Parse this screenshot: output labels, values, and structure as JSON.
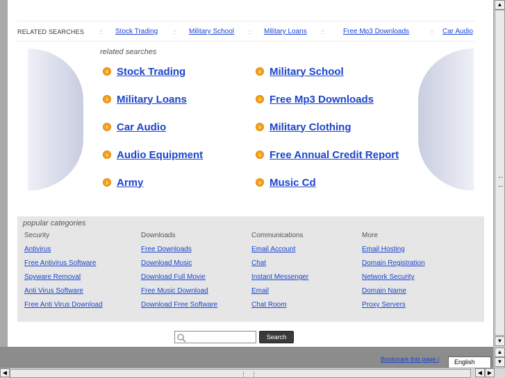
{
  "top_bar": {
    "label": "RELATED SEARCHES",
    "separator": "::",
    "links": [
      "Stock Trading",
      "Military School",
      "Military Loans",
      "Free Mp3 Downloads",
      "Car Audio"
    ]
  },
  "related": {
    "title": "related searches",
    "items": [
      "Stock Trading",
      "Military School",
      "Military Loans",
      "Free Mp3 Downloads",
      "Car Audio",
      "Military Clothing",
      "Audio Equipment",
      "Free Annual Credit Report",
      "Army",
      "Music Cd"
    ]
  },
  "popular": {
    "title": "popular categories",
    "columns": [
      {
        "heading": "Security",
        "links": [
          "Antivirus",
          "Free Antivirus Software",
          "Spyware Removal",
          "Anti Virus Software",
          "Free Anti Virus Download"
        ]
      },
      {
        "heading": "Downloads",
        "links": [
          "Free Downloads",
          "Download Music",
          "Download Full Movie",
          "Free Music Download",
          "Download Free Software"
        ]
      },
      {
        "heading": "Communications",
        "links": [
          "Email Account",
          "Chat",
          "Instant Messenger",
          "Email",
          "Chat Room"
        ]
      },
      {
        "heading": "More",
        "links": [
          "Email Hosting",
          "Domain Registration",
          "Network Security",
          "Domain Name",
          "Proxy Servers"
        ]
      }
    ]
  },
  "search": {
    "input_value": "",
    "button_label": "Search"
  },
  "footer": {
    "bookmark_label": "Bookmark this page |",
    "language": "English"
  },
  "colors": {
    "link": "#1a44cc",
    "accent_icon": "#f7a21b",
    "panel_bg": "#e6e6e6"
  },
  "icons": {
    "arrow": "circle-arrow-right-icon",
    "search": "magnifier-icon"
  }
}
